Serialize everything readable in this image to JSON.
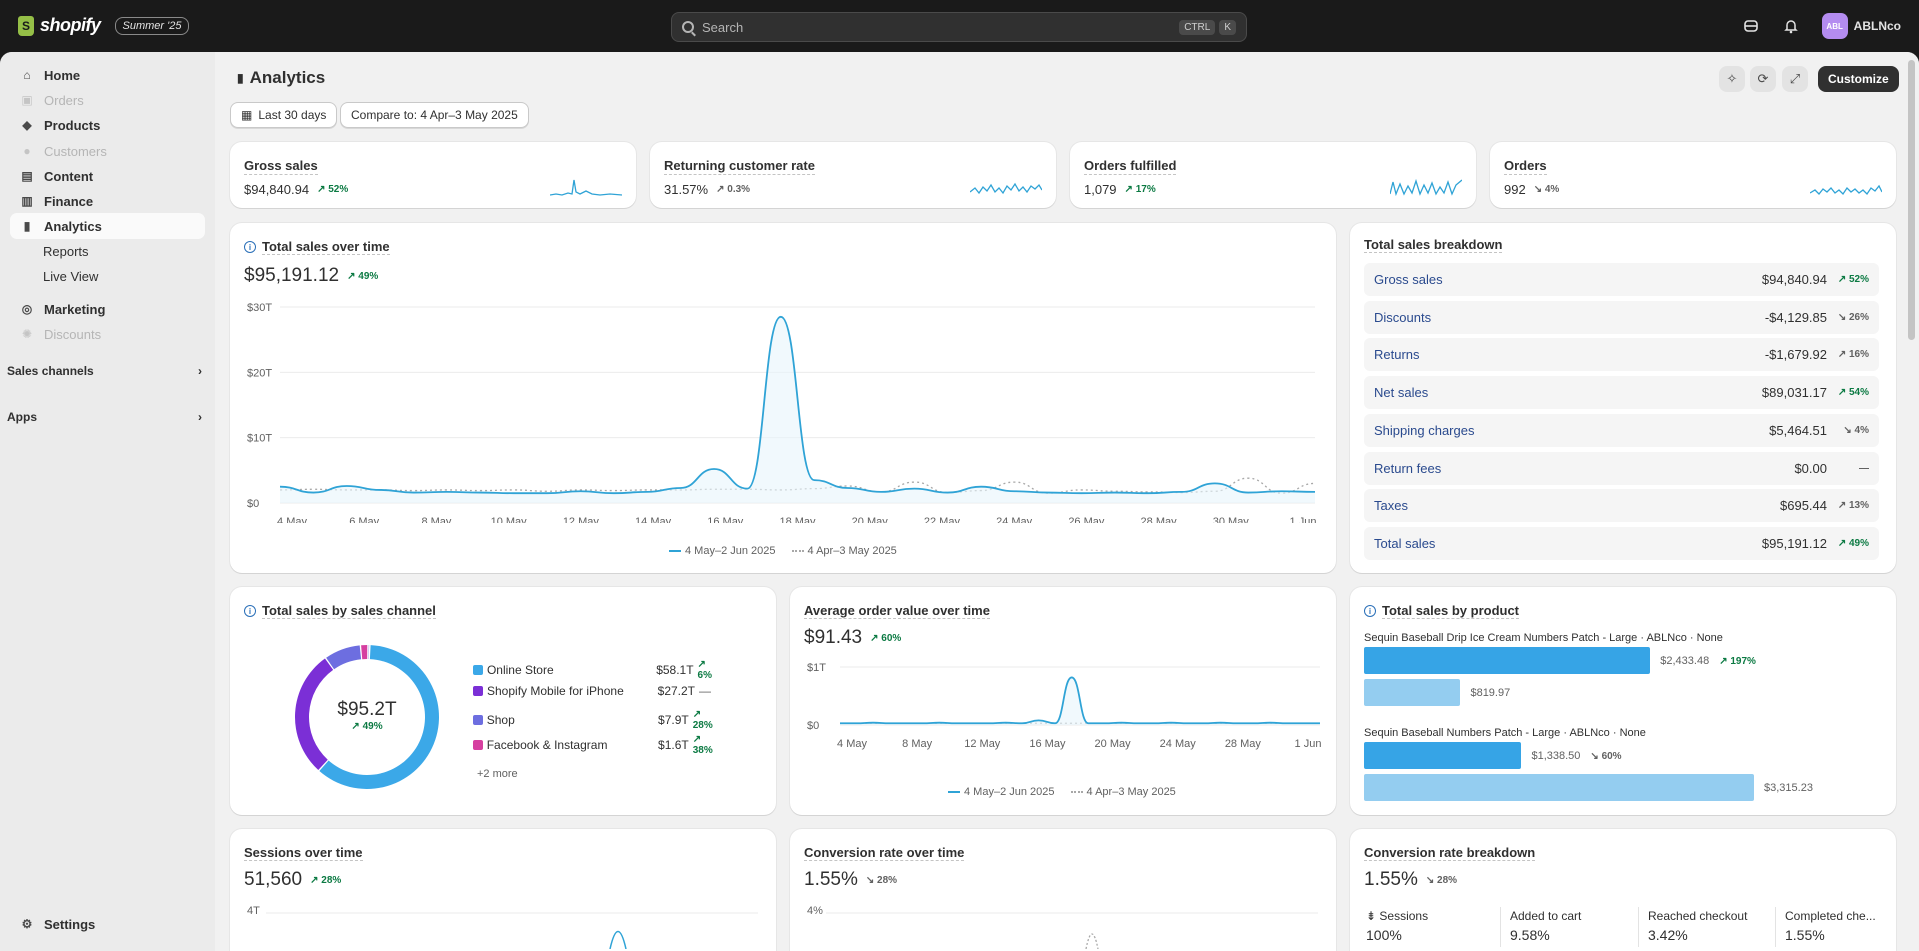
{
  "topbar": {
    "brand": "shopify",
    "edition_badge": "Summer '25",
    "search_placeholder": "Search",
    "shortcut_key1": "CTRL",
    "shortcut_key2": "K",
    "avatar_initials": "ABL",
    "store_name": "ABLNco",
    "icons": [
      "store-icon",
      "bell-icon"
    ]
  },
  "sidebar": {
    "items": [
      {
        "label": "Home",
        "icon": "home-icon",
        "state": "normal"
      },
      {
        "label": "Orders",
        "icon": "orders-icon",
        "state": "disabled"
      },
      {
        "label": "Products",
        "icon": "tag-icon",
        "state": "normal"
      },
      {
        "label": "Customers",
        "icon": "person-icon",
        "state": "disabled"
      },
      {
        "label": "Content",
        "icon": "content-icon",
        "state": "normal"
      },
      {
        "label": "Finance",
        "icon": "bank-icon",
        "state": "normal"
      },
      {
        "label": "Analytics",
        "icon": "bar-chart-icon",
        "state": "active"
      }
    ],
    "analytics_sub": [
      "Reports",
      "Live View"
    ],
    "items2": [
      {
        "label": "Marketing",
        "icon": "target-icon",
        "state": "normal"
      },
      {
        "label": "Discounts",
        "icon": "discount-icon",
        "state": "disabled"
      }
    ],
    "sales_channels": "Sales channels",
    "apps": "Apps",
    "settings": "Settings"
  },
  "header": {
    "title": "Analytics",
    "date_range": "Last 30 days",
    "compare": "Compare to: 4 Apr–3 May 2025",
    "customize": "Customize"
  },
  "kpis": [
    {
      "label": "Gross sales",
      "value": "$94,840.94",
      "change": "52%",
      "direction": "up"
    },
    {
      "label": "Returning customer rate",
      "value": "31.57%",
      "change": "0.3%",
      "direction": "up-neutral"
    },
    {
      "label": "Orders fulfilled",
      "value": "1,079",
      "change": "17%",
      "direction": "up"
    },
    {
      "label": "Orders",
      "value": "992",
      "change": "4%",
      "direction": "down"
    }
  ],
  "total_sales": {
    "title": "Total sales over time",
    "value": "$95,191.12",
    "change": "49%",
    "legend_current": "4 May–2 Jun 2025",
    "legend_previous": "4 Apr–3 May 2025"
  },
  "chart_data": [
    {
      "type": "line",
      "title": "Total sales over time",
      "y_ticks": [
        "$30T",
        "$20T",
        "$10T",
        "$0"
      ],
      "ylim": [
        0,
        30
      ],
      "x_ticks": [
        "4 May",
        "6 May",
        "8 May",
        "10 May",
        "12 May",
        "14 May",
        "16 May",
        "18 May",
        "20 May",
        "22 May",
        "24 May",
        "26 May",
        "28 May",
        "30 May",
        "1 Jun"
      ],
      "series": [
        {
          "name": "4 May–2 Jun 2025",
          "values": [
            2.5,
            1.6,
            2.6,
            2.0,
            1.6,
            1.7,
            1.6,
            1.5,
            1.5,
            1.8,
            1.5,
            1.7,
            2.3,
            5.2,
            2.2,
            28.5,
            3.5,
            2.3,
            1.7,
            2.2,
            1.6,
            2.5,
            1.8,
            1.6,
            1.5,
            1.6,
            1.5,
            1.7,
            3.0,
            1.6,
            1.8,
            1.7
          ]
        },
        {
          "name": "4 Apr–3 May 2025",
          "values": [
            2.0,
            2.1,
            2.0,
            2.0,
            1.9,
            2.0,
            1.9,
            2.0,
            1.8,
            2.0,
            1.9,
            2.0,
            2.0,
            2.1,
            2.1,
            2.0,
            2.2,
            2.6,
            1.7,
            3.2,
            1.6,
            1.9,
            3.2,
            1.5,
            2.0,
            1.8,
            1.7,
            1.6,
            1.8,
            3.8,
            1.5,
            3.0
          ]
        }
      ]
    },
    {
      "type": "line",
      "title": "Average order value over time",
      "y_ticks": [
        "$1T",
        "$0"
      ],
      "ylim": [
        0,
        1
      ],
      "x_ticks": [
        "4 May",
        "8 May",
        "12 May",
        "16 May",
        "20 May",
        "24 May",
        "28 May",
        "1 Jun"
      ],
      "series": [
        {
          "name": "4 May–2 Jun 2025",
          "values": [
            0.03,
            0.03,
            0.04,
            0.03,
            0.03,
            0.03,
            0.04,
            0.03,
            0.03,
            0.03,
            0.04,
            0.03,
            0.08,
            0.03,
            0.82,
            0.03,
            0.03,
            0.04,
            0.03,
            0.03,
            0.04,
            0.03,
            0.03,
            0.04,
            0.03,
            0.03,
            0.04,
            0.03,
            0.03,
            0.03
          ]
        },
        {
          "name": "4 Apr–3 May 2025",
          "values": [
            0.03,
            0.03,
            0.03,
            0.03,
            0.03,
            0.03,
            0.03,
            0.03,
            0.03,
            0.03,
            0.03,
            0.03,
            0.03,
            0.03,
            0.03,
            0.03,
            0.03,
            0.03,
            0.03,
            0.03,
            0.03,
            0.03,
            0.03,
            0.03,
            0.03,
            0.03,
            0.03,
            0.03,
            0.03,
            0.03
          ]
        }
      ]
    },
    {
      "type": "pie",
      "title": "Total sales by sales channel",
      "center_value": "$95.2T",
      "center_change": "49%",
      "slices": [
        {
          "name": "Online Store",
          "value": 58.1,
          "color": "#3ba8e8"
        },
        {
          "name": "Shopify Mobile for iPhone",
          "value": 27.2,
          "color": "#7b2fd6"
        },
        {
          "name": "Shop",
          "value": 7.9,
          "color": "#6d6ee0"
        },
        {
          "name": "Facebook & Instagram",
          "value": 1.6,
          "color": "#d63fa0"
        },
        {
          "name": "other",
          "value": 0.4,
          "color": "#8e8ef0"
        }
      ]
    },
    {
      "type": "bar",
      "title": "Total sales by product",
      "categories": [
        "Sequin Baseball Drip Ice Cream Numbers Patch - Large · ABLNco · None",
        "Sequin Baseball Numbers Patch - Large · ABLNco · None"
      ],
      "series": [
        {
          "name": "4 May–2 Jun 2025",
          "values": [
            2433.48,
            1338.5
          ]
        },
        {
          "name": "4 Apr–3 May 2025",
          "values": [
            819.97,
            3315.23
          ]
        }
      ]
    }
  ],
  "breakdown": {
    "title": "Total sales breakdown",
    "rows": [
      {
        "label": "Gross sales",
        "value": "$94,840.94",
        "change": "52%",
        "direction": "up"
      },
      {
        "label": "Discounts",
        "value": "-$4,129.85",
        "change": "26%",
        "direction": "down"
      },
      {
        "label": "Returns",
        "value": "-$1,679.92",
        "change": "16%",
        "direction": "neutral"
      },
      {
        "label": "Net sales",
        "value": "$89,031.17",
        "change": "54%",
        "direction": "up"
      },
      {
        "label": "Shipping charges",
        "value": "$5,464.51",
        "change": "4%",
        "direction": "down"
      },
      {
        "label": "Return fees",
        "value": "$0.00",
        "change": "—",
        "direction": "none"
      },
      {
        "label": "Taxes",
        "value": "$695.44",
        "change": "13%",
        "direction": "neutral"
      },
      {
        "label": "Total sales",
        "value": "$95,191.12",
        "change": "49%",
        "direction": "up"
      }
    ]
  },
  "by_channel": {
    "title": "Total sales by sales channel",
    "center": "$95.2T",
    "center_change": "49%",
    "rows": [
      {
        "name": "Online Store",
        "value": "$58.1T",
        "change": "6%",
        "color": "#3ba8e8"
      },
      {
        "name": "Shopify Mobile for iPhone",
        "value": "$27.2T",
        "change": "—",
        "color": "#7b2fd6"
      },
      {
        "name": "Shop",
        "value": "$7.9T",
        "change": "28%",
        "color": "#6d6ee0"
      },
      {
        "name": "Facebook & Instagram",
        "value": "$1.6T",
        "change": "38%",
        "color": "#d63fa0"
      }
    ],
    "more": "+2 more"
  },
  "aov": {
    "title": "Average order value over time",
    "value": "$91.43",
    "change": "60%",
    "legend_current": "4 May–2 Jun 2025",
    "legend_previous": "4 Apr–3 May 2025"
  },
  "by_product": {
    "title": "Total sales by product",
    "p1_label": "Sequin Baseball Drip Ice Cream Numbers Patch - Large · ABLNco · None",
    "p1_cur": "$2,433.48",
    "p1_change": "197%",
    "p1_prev": "$819.97",
    "p2_label": "Sequin Baseball Numbers Patch - Large · ABLNco · None",
    "p2_cur": "$1,338.50",
    "p2_change": "60%",
    "p2_prev": "$3,315.23"
  },
  "sessions": {
    "title": "Sessions over time",
    "value": "51,560",
    "change": "28%",
    "tick": "4T"
  },
  "conversion": {
    "title": "Conversion rate over time",
    "value": "1.55%",
    "change": "28%",
    "tick": "4%"
  },
  "conv_breakdown": {
    "title": "Conversion rate breakdown",
    "value": "1.55%",
    "change": "28%",
    "cols": [
      {
        "label": "Sessions",
        "value": "100%"
      },
      {
        "label": "Added to cart",
        "value": "9.58%"
      },
      {
        "label": "Reached checkout",
        "value": "3.42%"
      },
      {
        "label": "Completed che...",
        "value": "1.55%"
      }
    ]
  }
}
